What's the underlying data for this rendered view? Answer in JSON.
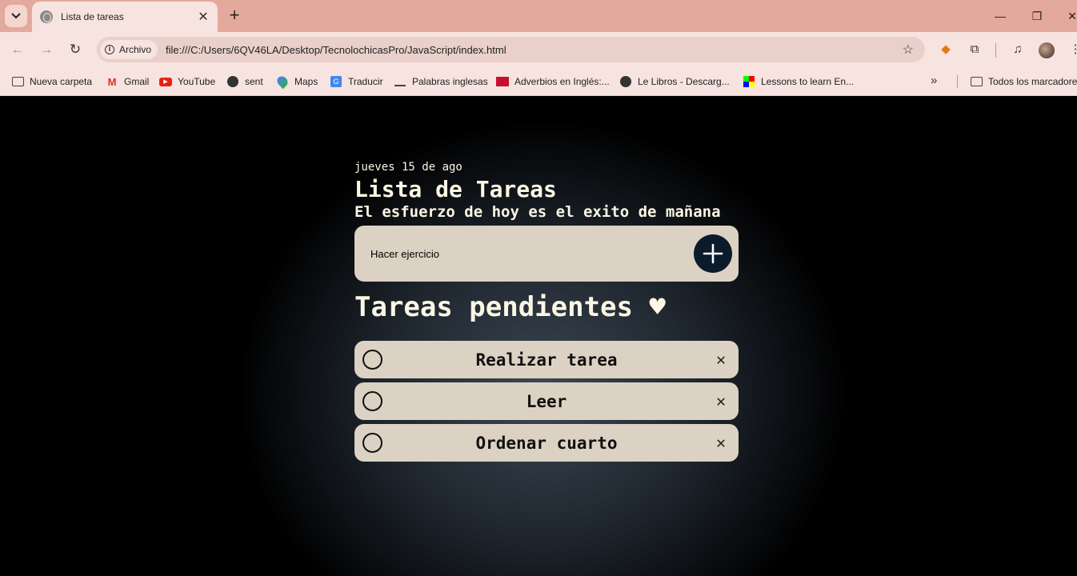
{
  "browser": {
    "tab_title": "Lista de tareas",
    "omnibox_chip": "Archivo",
    "url": "file:///C:/Users/6QV46LA/Desktop/TecnolochicasPro/JavaScript/index.html"
  },
  "bookmarks": [
    {
      "label": "Nueva carpeta",
      "icon": "folder-icon"
    },
    {
      "label": "Gmail",
      "icon": "gmail-icon"
    },
    {
      "label": "YouTube",
      "icon": "youtube-icon"
    },
    {
      "label": "sent",
      "icon": "globe-icon"
    },
    {
      "label": "Maps",
      "icon": "maps-icon"
    },
    {
      "label": "Traducir",
      "icon": "translate-icon"
    },
    {
      "label": "Palabras inglesas",
      "icon": "bookmark-icon"
    },
    {
      "label": "Adverbios en Inglés:...",
      "icon": "uk-flag-icon"
    },
    {
      "label": "Le Libros - Descarg...",
      "icon": "globe-icon"
    },
    {
      "label": "Lessons to learn En...",
      "icon": "colorful-icon"
    }
  ],
  "bookmarks_all": "Todos los marcadores",
  "app": {
    "date": "jueves 15 de ago",
    "title": "Lista de Tareas",
    "subtitle": "El esfuerzo de hoy es el exito de mañana",
    "input_value": "Hacer ejercicio",
    "pending_heading": "Tareas pendientes ♥",
    "tasks": [
      {
        "text": "Realizar tarea"
      },
      {
        "text": "Leer"
      },
      {
        "text": "Ordenar cuarto"
      }
    ]
  }
}
